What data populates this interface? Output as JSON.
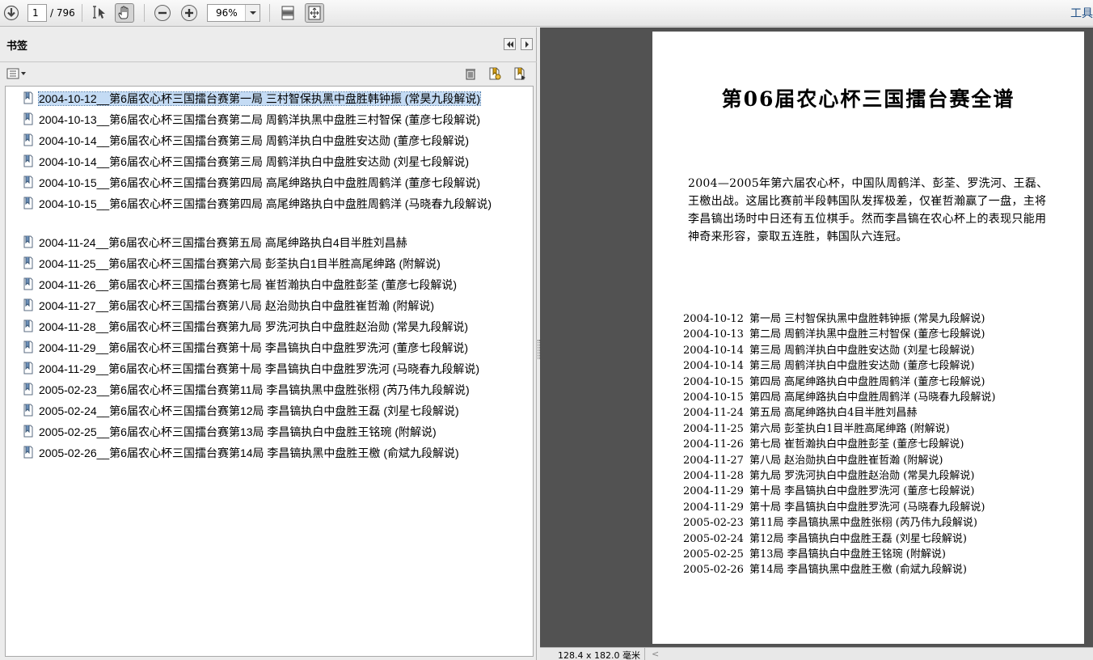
{
  "toolbar": {
    "page_current": "1",
    "page_total": "/ 796",
    "zoom": "96%",
    "tools_label": "工具",
    "icons": [
      "download-arrow-icon",
      "select-cursor-icon",
      "hand-icon",
      "zoom-out-icon",
      "zoom-in-icon",
      "fit-width-icon",
      "fit-page-icon"
    ]
  },
  "bookmarks_panel": {
    "title": "书签",
    "items": [
      {
        "label": "2004-10-12__第6届农心杯三国擂台赛第一局 三村智保执黑中盘胜韩钟振 (常昊九段解说)",
        "selected": true
      },
      {
        "label": "2004-10-13__第6届农心杯三国擂台赛第二局 周鹤洋执黑中盘胜三村智保 (董彦七段解说)"
      },
      {
        "label": "2004-10-14__第6届农心杯三国擂台赛第三局 周鹤洋执白中盘胜安达勋 (董彦七段解说)"
      },
      {
        "label": "2004-10-14__第6届农心杯三国擂台赛第三局 周鹤洋执白中盘胜安达勋 (刘星七段解说)"
      },
      {
        "label": "2004-10-15__第6届农心杯三国擂台赛第四局 高尾绅路执白中盘胜周鹤洋 (董彦七段解说)"
      },
      {
        "label": "2004-10-15__第6届农心杯三国擂台赛第四局 高尾绅路执白中盘胜周鹤洋 (马晓春九段解说)"
      },
      {
        "label": "2004-11-24__第6届农心杯三国擂台赛第五局 高尾绅路执白4目半胜刘昌赫"
      },
      {
        "label": "2004-11-25__第6届农心杯三国擂台赛第六局 彭荃执白1目半胜高尾绅路 (附解说)"
      },
      {
        "label": "2004-11-26__第6届农心杯三国擂台赛第七局 崔哲瀚执白中盘胜彭荃 (董彦七段解说)"
      },
      {
        "label": "2004-11-27__第6届农心杯三国擂台赛第八局 赵治勋执白中盘胜崔哲瀚 (附解说)"
      },
      {
        "label": "2004-11-28__第6届农心杯三国擂台赛第九局 罗洗河执白中盘胜赵治勋 (常昊九段解说)"
      },
      {
        "label": "2004-11-29__第6届农心杯三国擂台赛第十局 李昌镐执白中盘胜罗洗河 (董彦七段解说)"
      },
      {
        "label": "2004-11-29__第6届农心杯三国擂台赛第十局 李昌镐执白中盘胜罗洗河 (马晓春九段解说)"
      },
      {
        "label": "2005-02-23__第6届农心杯三国擂台赛第11局 李昌镐执黑中盘胜张栩 (芮乃伟九段解说)"
      },
      {
        "label": "2005-02-24__第6届农心杯三国擂台赛第12局 李昌镐执白中盘胜王磊 (刘星七段解说)"
      },
      {
        "label": "2005-02-25__第6届农心杯三国擂台赛第13局 李昌镐执白中盘胜王铭琬 (附解说)"
      },
      {
        "label": "2005-02-26__第6届农心杯三国擂台赛第14局 李昌镐执黑中盘胜王檄 (俞斌九段解说)"
      }
    ]
  },
  "document": {
    "title": "第06届农心杯三国擂台赛全谱",
    "intro": "2004—2005年第六届农心杯，中国队周鹤洋、彭荃、罗洗河、王磊、王檄出战。这届比赛前半段韩国队发挥极差，仅崔哲瀚赢了一盘，主将李昌镐出场时中日还有五位棋手。然而李昌镐在农心杯上的表现只能用神奇来形容，豪取五连胜，韩国队六连冠。",
    "games": [
      {
        "date": "2004-10-12",
        "desc": "第一局 三村智保执黑中盘胜韩钟振 (常昊九段解说)"
      },
      {
        "date": "2004-10-13",
        "desc": "第二局 周鹤洋执黑中盘胜三村智保 (董彦七段解说)"
      },
      {
        "date": "2004-10-14",
        "desc": "第三局 周鹤洋执白中盘胜安达勋 (刘星七段解说)"
      },
      {
        "date": "2004-10-14",
        "desc": "第三局 周鹤洋执白中盘胜安达勋 (董彦七段解说)"
      },
      {
        "date": "2004-10-15",
        "desc": "第四局 高尾绅路执白中盘胜周鹤洋 (董彦七段解说)"
      },
      {
        "date": "2004-10-15",
        "desc": "第四局 高尾绅路执白中盘胜周鹤洋 (马晓春九段解说)"
      },
      {
        "date": "2004-11-24",
        "desc": "第五局 高尾绅路执白4目半胜刘昌赫"
      },
      {
        "date": "2004-11-25",
        "desc": "第六局 彭荃执白1目半胜高尾绅路 (附解说)"
      },
      {
        "date": "2004-11-26",
        "desc": "第七局 崔哲瀚执白中盘胜彭荃 (董彦七段解说)"
      },
      {
        "date": "2004-11-27",
        "desc": "第八局 赵治勋执白中盘胜崔哲瀚 (附解说)"
      },
      {
        "date": "2004-11-28",
        "desc": "第九局 罗洗河执白中盘胜赵治勋 (常昊九段解说)"
      },
      {
        "date": "2004-11-29",
        "desc": "第十局 李昌镐执白中盘胜罗洗河 (董彦七段解说)"
      },
      {
        "date": "2004-11-29",
        "desc": "第十局 李昌镐执白中盘胜罗洗河 (马晓春九段解说)"
      },
      {
        "date": "2005-02-23",
        "desc": "第11局 李昌镐执黑中盘胜张栩 (芮乃伟九段解说)"
      },
      {
        "date": "2005-02-24",
        "desc": "第12局 李昌镐执白中盘胜王磊 (刘星七段解说)"
      },
      {
        "date": "2005-02-25",
        "desc": "第13局 李昌镐执白中盘胜王铭琬 (附解说)"
      },
      {
        "date": "2005-02-26",
        "desc": "第14局 李昌镐执黑中盘胜王檄 (俞斌九段解说)"
      }
    ]
  },
  "status": {
    "page_size": "128.4 x 182.0 毫米"
  },
  "colors": {
    "selection": "#c4dbf4",
    "doc_background": "#525252",
    "tools_label": "#1f4f86"
  }
}
